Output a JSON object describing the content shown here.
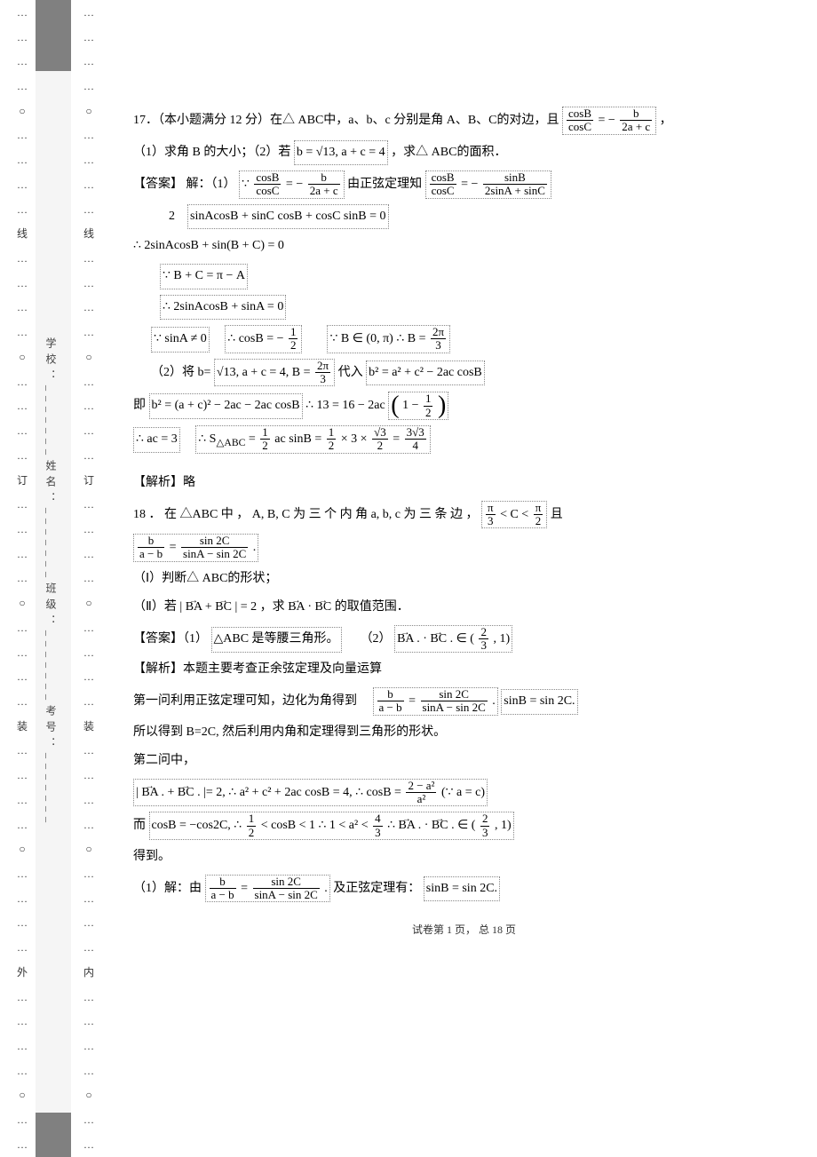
{
  "gutter": {
    "left_labels": [
      "…",
      "…",
      "…",
      "…",
      "○",
      "…",
      "…",
      "…",
      "…",
      "线",
      "…",
      "…",
      "…",
      "…",
      "○",
      "…",
      "…",
      "…",
      "…",
      "订",
      "…",
      "…",
      "…",
      "…",
      "○",
      "…",
      "…",
      "…",
      "…",
      "装",
      "…",
      "…",
      "…",
      "…",
      "○",
      "…",
      "…",
      "…",
      "…",
      "外",
      "…",
      "…",
      "…",
      "…",
      "○",
      "…",
      "…"
    ],
    "right_labels": [
      "…",
      "…",
      "…",
      "…",
      "○",
      "…",
      "…",
      "…",
      "…",
      "线",
      "…",
      "…",
      "…",
      "…",
      "○",
      "…",
      "…",
      "…",
      "…",
      "订",
      "…",
      "…",
      "…",
      "…",
      "○",
      "…",
      "…",
      "…",
      "…",
      "装",
      "…",
      "…",
      "…",
      "…",
      "○",
      "…",
      "…",
      "…",
      "…",
      "内",
      "…",
      "…",
      "…",
      "…",
      "○",
      "…",
      "…"
    ],
    "vertical_text": "学校：_______姓名：_______班级：_______考号：_______"
  },
  "q17": {
    "stem_a": "17．（本小题满分  12 分）在△ ABC中，a、b、c 分别是角  A、B、C的对边，且",
    "frac1_num": "cosB",
    "frac1_den": "cosC",
    "eq_mid": " = −",
    "frac2_num": "b",
    "frac2_den": "2a + c",
    "comma": "，",
    "part1": "（1）求角 B 的大小；（2）若",
    "cond2": "b = √13, a + c = 4",
    "part1b": "，求△ ABC的面积．",
    "ans_label": "【答案】 解：（1）",
    "sol_l1a": "∵ ",
    "sol_frac1n": "cosB",
    "sol_frac1d": "cosC",
    "sol_l1b": " = −",
    "sol_frac2n": "b",
    "sol_frac2d": "2a + c",
    "sol_l1c": "        由正弦定理知  ",
    "sol_frac3n": "cosB",
    "sol_frac3d": "cosC",
    "sol_l1d": " = −",
    "sol_frac4n": "sinB",
    "sol_frac4d": "2sinA + sinC",
    "sol_l2a": "2",
    "sol_l2b": "sinAcosB + sinC cosB + cosC sinB = 0",
    "sol_l3": "∴ 2sinAcosB + sin(B + C) = 0",
    "sol_l4": "∵ B + C = π − A",
    "sol_l5": "∴ 2sinAcosB + sinA = 0",
    "sol_l6": "∵ sinA ≠ 0",
    "sol_l6b": "∴ cosB = −",
    "sol_l6f_n": "1",
    "sol_l6f_d": "2",
    "sol_l6c": "∵ B ∈ (0, π)   ∴ B = ",
    "sol_l6g_n": "2π",
    "sol_l6g_d": "3",
    "sol_l7a": "（2）将 b=",
    "sol_l7b": "√13, a + c = 4, B = ",
    "sol_l7f_n": "2π",
    "sol_l7f_d": "3",
    "sol_l7c": " 代入 ",
    "sol_l7d": "b² = a² + c² − 2ac cosB",
    "sol_l8a": "即 ",
    "sol_l8b": "b² = (a + c)² − 2ac − 2ac cosB",
    "sol_l8c": " ∴ 13 = 16 − 2ac",
    "sol_l8p1": "(",
    "sol_l8d": "1 − ",
    "sol_l8f_n": "1",
    "sol_l8f_d": "2",
    "sol_l8p2": ")",
    "sol_l9a": "∴ ac = 3",
    "sol_l9b": "∴ S",
    "sol_l9sub": "△ABC",
    "sol_l9c": " = ",
    "sol_l9f1_n": "1",
    "sol_l9f1_d": "2",
    "sol_l9d": "ac sinB = ",
    "sol_l9f2_n": "1",
    "sol_l9f2_d": "2",
    "sol_l9e": " × 3 × ",
    "sol_l9f3_n": "√3",
    "sol_l9f3_d": "2",
    "sol_l9f": " = ",
    "sol_l9f4_n": "3√3",
    "sol_l9f4_d": "4",
    "analysis": "【解析】略"
  },
  "q18": {
    "stem_a": "18 ． 在 △ABC 中 ，  A, B, C  为 三 个 内 角  a, b, c  为 三 条 边 ，",
    "stem_f1_n": "π",
    "stem_f1_d": "3",
    "stem_mid": " < C < ",
    "stem_f2_n": "π",
    "stem_f2_d": "2",
    "stem_b": "  且",
    "frac1_n": "b",
    "frac1_d": "a − b",
    "frac_eq": " = ",
    "frac2_n": "sin 2C",
    "frac2_d": "sinA − sin 2C",
    "frac_end": ".",
    "p1": "（Ⅰ）判断△ ABC的形状；",
    "p2a": "（Ⅱ）若 | ",
    "p2_vec1": "BA",
    "p2_plus": " + ",
    "p2_vec2": "BC",
    "p2b": " | = 2 ，求 ",
    "p2_vec3": "BA",
    "p2_dot": " · ",
    "p2_vec4": "BC",
    "p2c": " 的取值范围．",
    "ans_label": "【答案】（1）",
    "ans1": "△ABC 是等腰三角形。",
    "ans2a": "（2）",
    "ans2_vec1": "BA",
    "ans2_dot": ". · ",
    "ans2_vec2": "BC",
    "ans2b": ". ∈ (",
    "ans2_f_n": "2",
    "ans2_f_d": "3",
    "ans2c": ", 1)",
    "analysis_a": "【解析】本题主要考查正余弦定理及向量运算",
    "analysis_b": "第一问利用正弦定理可知，边化为角得到",
    "an_f1_n": "b",
    "an_f1_d": "a − b",
    "an_eq": " = ",
    "an_f2_n": "sin 2C",
    "an_f2_d": "sinA − sin 2C",
    "an_end": ". ",
    "an_sinb": "sinB = sin 2C.",
    "analysis_c": "所以得到  B=2C,  然后利用内角和定理得到三角形的形状。",
    "analysis_d": "第二问中，",
    "l2a": "| ",
    "l2_vec1": "BA",
    "l2_plus": ". + ",
    "l2_vec2": "BC",
    "l2b": ". |= 2, ∴ a² + c² + 2ac cosB = 4, ∴ cosB = ",
    "l2_f_n": "2 − a²",
    "l2_f_d": "a²",
    "l2c": "(∵ a = c)",
    "l3a": "而 ",
    "l3b": "cosB = −cos2C, ∴ ",
    "l3_f1_n": "1",
    "l3_f1_d": "2",
    "l3c": " < cosB < 1 ∴ 1 < a² < ",
    "l3_f2_n": "4",
    "l3_f2_d": "3",
    "l3d": " ∴ ",
    "l3_vec1": "BA",
    "l3_dot": ". · ",
    "l3_vec2": "BC",
    "l3e": ". ∈ (",
    "l3_f3_n": "2",
    "l3_f3_d": "3",
    "l3f": ", 1)",
    "got": "得到。",
    "sol1a": "（1）解：由",
    "sol1_f1_n": "b",
    "sol1_f1_d": "a − b",
    "sol1_eq": " = ",
    "sol1_f2_n": "sin 2C",
    "sol1_f2_d": "sinA − sin 2C",
    "sol1_end": ".",
    "sol1b": " 及正弦定理有：",
    "sol1c": "sinB = sin 2C."
  },
  "footer": "试卷第 1 页， 总 18 页"
}
